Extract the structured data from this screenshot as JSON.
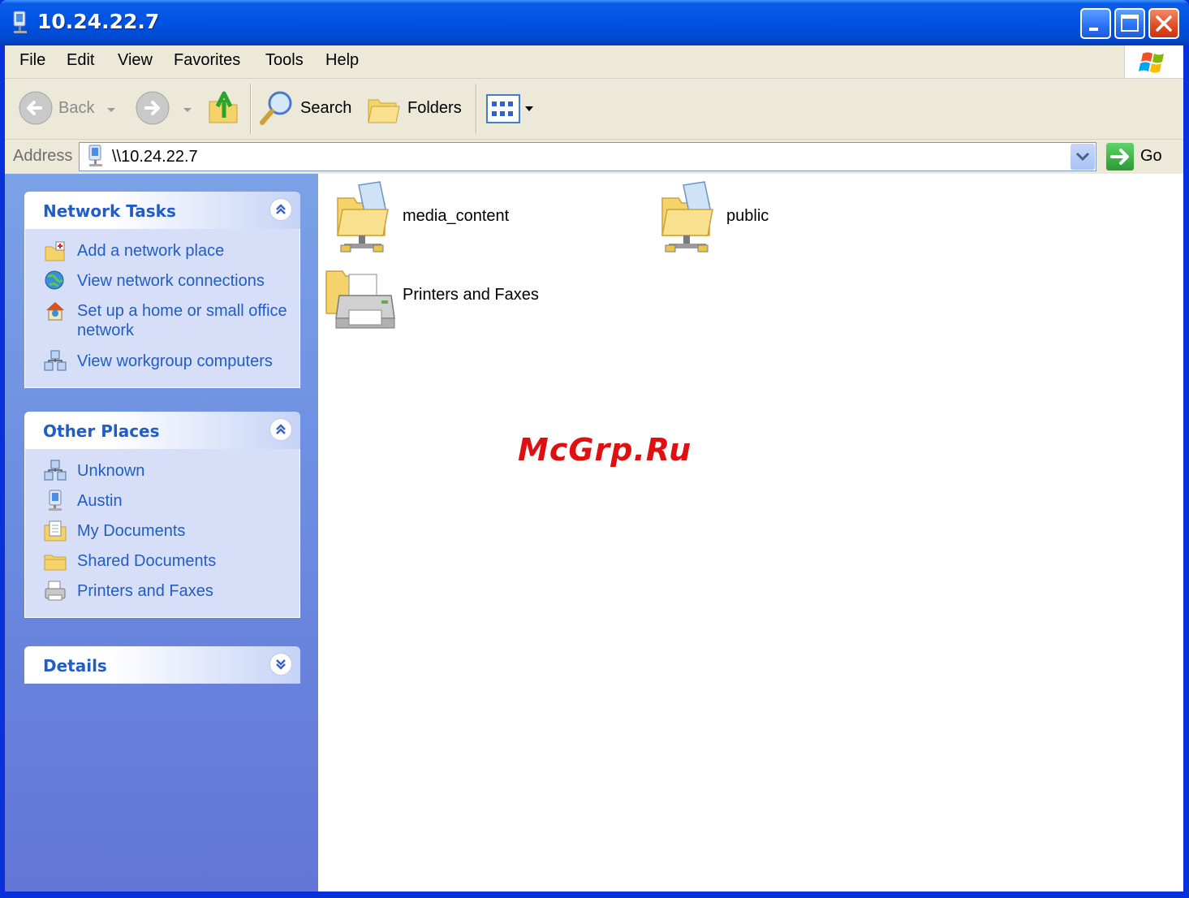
{
  "window": {
    "title": "10.24.22.7",
    "controls": [
      "minimize",
      "maximize",
      "close"
    ]
  },
  "menu": {
    "items": [
      "File",
      "Edit",
      "View",
      "Favorites",
      "Tools",
      "Help"
    ]
  },
  "toolbar": {
    "back_label": "Back",
    "search_label": "Search",
    "folders_label": "Folders"
  },
  "address": {
    "label": "Address",
    "value": "\\\\10.24.22.7",
    "go_label": "Go"
  },
  "sidebar": {
    "network_tasks": {
      "title": "Network Tasks",
      "items": [
        {
          "label": "Add a network place",
          "icon": "add-network-place-icon"
        },
        {
          "label": "View network connections",
          "icon": "network-connections-icon"
        },
        {
          "label": "Set up a home or small office network",
          "icon": "home-network-icon"
        },
        {
          "label": "View workgroup computers",
          "icon": "workgroup-icon"
        }
      ]
    },
    "other_places": {
      "title": "Other Places",
      "items": [
        {
          "label": "Unknown",
          "icon": "workgroup-icon"
        },
        {
          "label": "Austin",
          "icon": "computer-icon"
        },
        {
          "label": "My Documents",
          "icon": "my-documents-icon"
        },
        {
          "label": "Shared Documents",
          "icon": "folder-icon"
        },
        {
          "label": "Printers and Faxes",
          "icon": "printer-icon"
        }
      ]
    },
    "details": {
      "title": "Details"
    }
  },
  "content": {
    "items": [
      {
        "label": "media_content",
        "icon": "shared-folder-icon"
      },
      {
        "label": "public",
        "icon": "shared-folder-icon"
      },
      {
        "label": "Printers and Faxes",
        "icon": "printers-folder-icon"
      }
    ]
  },
  "watermark": "McGrp.Ru",
  "colors": {
    "titlebar": "#0054e3",
    "sidebar_link": "#215dc6",
    "watermark": "#e01010"
  }
}
